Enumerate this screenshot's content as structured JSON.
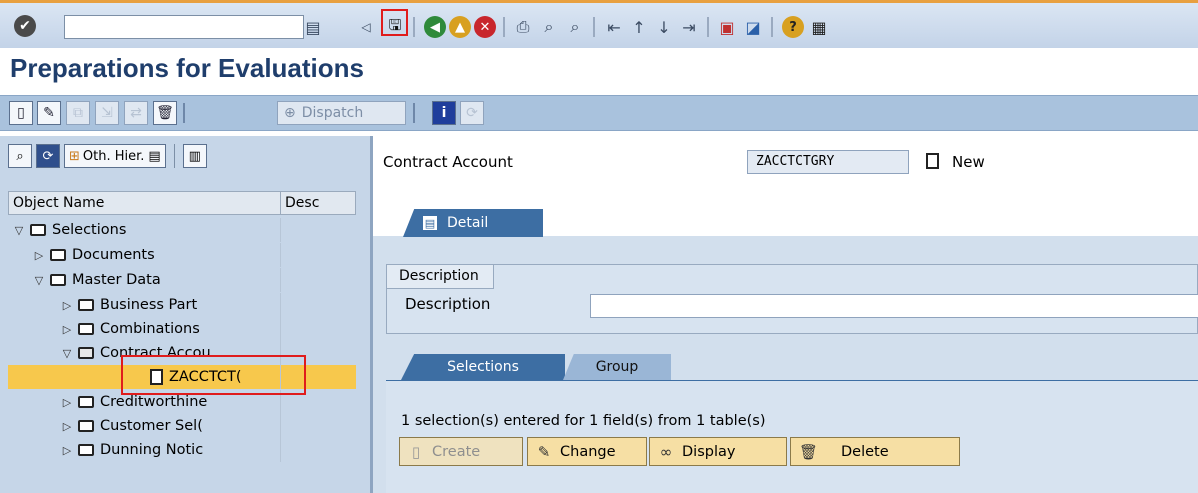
{
  "window": {
    "title": "Preparations for Evaluations",
    "command_field": {
      "value": "",
      "placeholder": ""
    }
  },
  "app_toolbar": {
    "dispatch_label": "Dispatch"
  },
  "tree": {
    "toolbar": {
      "oth_hier_label": "Oth. Hier."
    },
    "columns": [
      "Object Name",
      "Desc"
    ],
    "nodes": [
      {
        "label": "Selections",
        "level": 0,
        "expanded": true,
        "type": "folder"
      },
      {
        "label": "Documents",
        "level": 1,
        "expanded": false,
        "type": "folder"
      },
      {
        "label": "Master Data",
        "level": 1,
        "expanded": true,
        "type": "folder"
      },
      {
        "label": "Business Part",
        "level": 2,
        "expanded": false,
        "type": "folder"
      },
      {
        "label": "Combinations",
        "level": 2,
        "expanded": false,
        "type": "folder"
      },
      {
        "label": "Contract Accou",
        "level": 2,
        "expanded": true,
        "type": "folder-open"
      },
      {
        "label": "ZACCTCT(",
        "level": 3,
        "expanded": null,
        "type": "doc",
        "selected": true
      },
      {
        "label": "Creditworthine",
        "level": 2,
        "expanded": false,
        "type": "folder"
      },
      {
        "label": "Customer Sel(",
        "level": 2,
        "expanded": false,
        "type": "folder"
      },
      {
        "label": "Dunning Notic",
        "level": 2,
        "expanded": false,
        "type": "folder"
      }
    ]
  },
  "detail": {
    "contract_account_label": "Contract Account",
    "contract_account_value": "ZACCTCTGRY",
    "status_label": "New",
    "detail_tab_label": "Detail",
    "description_group_title": "Description",
    "description_label": "Description",
    "description_value": "",
    "tabs": {
      "selections": "Selections",
      "group": "Group"
    },
    "selection_info": "1 selection(s) entered for 1 field(s) from 1 table(s)",
    "buttons": {
      "create": "Create",
      "change": "Change",
      "display": "Display",
      "delete": "Delete"
    }
  },
  "colors": {
    "title": "#1f3e6c",
    "tab_active": "#3d6ea3",
    "tree_selected": "#f7c84c",
    "highlight_box": "#e01c1c"
  }
}
